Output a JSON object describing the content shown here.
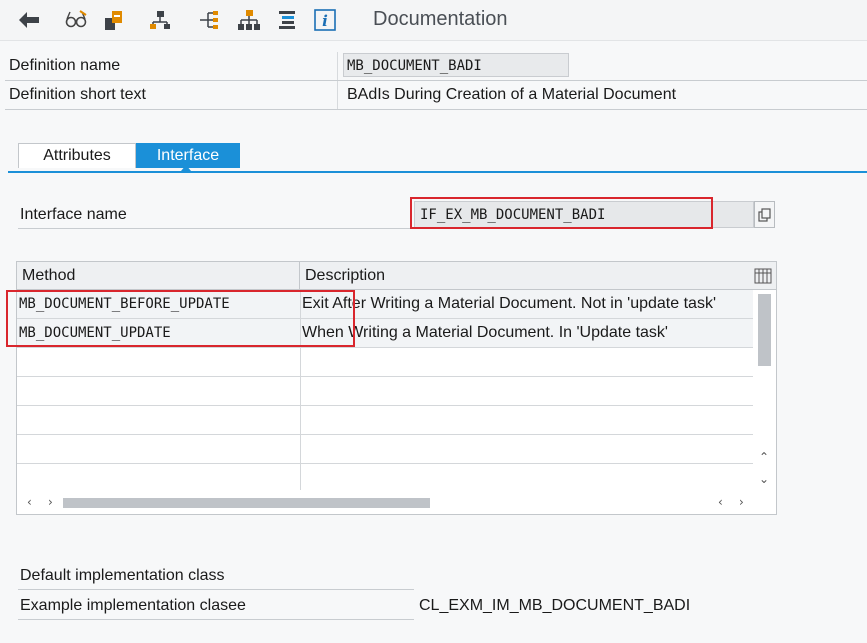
{
  "toolbar": {
    "title": "Documentation",
    "icons": [
      "back-arrow-icon",
      "glasses-icon",
      "object-hierarchy-icon",
      "tree-icon",
      "distribute-icon",
      "org-tree-icon",
      "align-icon",
      "info-icon"
    ]
  },
  "header": {
    "def_name_label": "Definition name",
    "def_name_value": "MB_DOCUMENT_BADI",
    "def_short_label": "Definition short text",
    "def_short_value": "BAdIs During Creation of a Material Document"
  },
  "tabs": {
    "attributes": "Attributes",
    "interface": "Interface"
  },
  "interface": {
    "label": "Interface name",
    "value": "IF_EX_MB_DOCUMENT_BADI"
  },
  "table": {
    "col_method": "Method",
    "col_description": "Description",
    "rows": [
      {
        "method": "MB_DOCUMENT_BEFORE_UPDATE",
        "description": "Exit After Writing a Material Document. Not in 'update task'"
      },
      {
        "method": "MB_DOCUMENT_UPDATE",
        "description": "When Writing a Material Document. In 'Update task'"
      }
    ]
  },
  "footer": {
    "default_label": "Default implementation class",
    "example_label": "Example implementation clasee",
    "example_value": "CL_EXM_IM_MB_DOCUMENT_BADI"
  },
  "colors": {
    "accent": "#1b90d8",
    "highlight": "#d9262d"
  }
}
